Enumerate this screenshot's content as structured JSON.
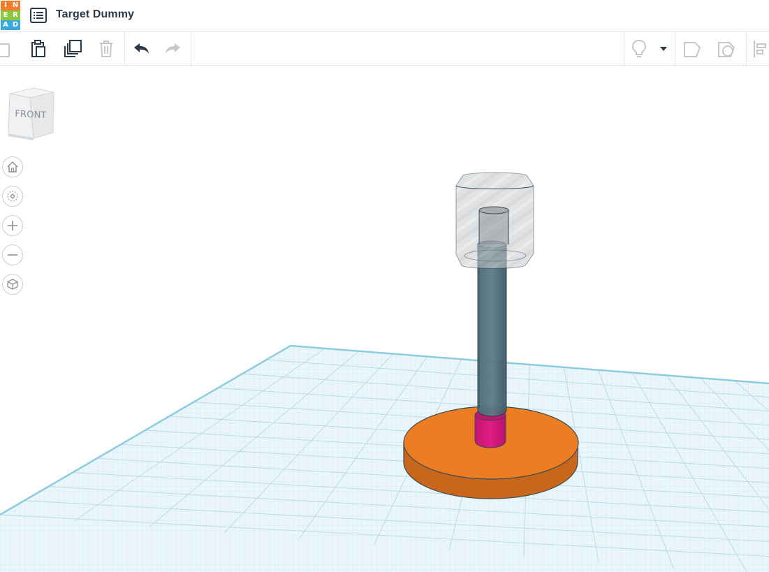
{
  "app": {
    "logo_letters": [
      "I",
      "N",
      "E",
      "R",
      "A",
      "D"
    ],
    "logo_colors": [
      "#f27d2b",
      "#f27d2b",
      "#8dc63f",
      "#8dc63f",
      "#39a9e0",
      "#39a9e0"
    ],
    "design_title": "Target Dummy"
  },
  "toolbar": {
    "buttons": [
      {
        "name": "copy-icon",
        "enabled": false
      },
      {
        "name": "paste-icon",
        "enabled": true
      },
      {
        "name": "duplicate-icon",
        "enabled": true
      },
      {
        "name": "delete-icon",
        "enabled": false
      },
      {
        "name": "undo-icon",
        "enabled": true
      },
      {
        "name": "redo-icon",
        "enabled": false
      },
      {
        "name": "lightbulb-icon",
        "enabled": false
      },
      {
        "name": "dropdown-arrow-icon",
        "enabled": true
      },
      {
        "name": "shape-solid-icon",
        "enabled": false
      },
      {
        "name": "shape-hole-icon",
        "enabled": false
      },
      {
        "name": "align-icon",
        "enabled": false
      }
    ]
  },
  "viewcube": {
    "face_label": "FRONT"
  },
  "view_controls": [
    {
      "name": "home-view-icon"
    },
    {
      "name": "fit-all-icon"
    },
    {
      "name": "zoom-in-icon"
    },
    {
      "name": "zoom-out-icon"
    },
    {
      "name": "ortho-perspective-icon"
    }
  ],
  "scene": {
    "workplane_color": "#e8f6fb",
    "grid_color": "#b9dcea",
    "shapes": [
      {
        "name": "base-disc",
        "color": "#ec7d22"
      },
      {
        "name": "pink-cylinder",
        "color": "#d2157a"
      },
      {
        "name": "shaft-cylinder",
        "color": "#3e5966"
      },
      {
        "name": "head-hole-cylinder",
        "color": "#bfc3c6"
      }
    ]
  }
}
